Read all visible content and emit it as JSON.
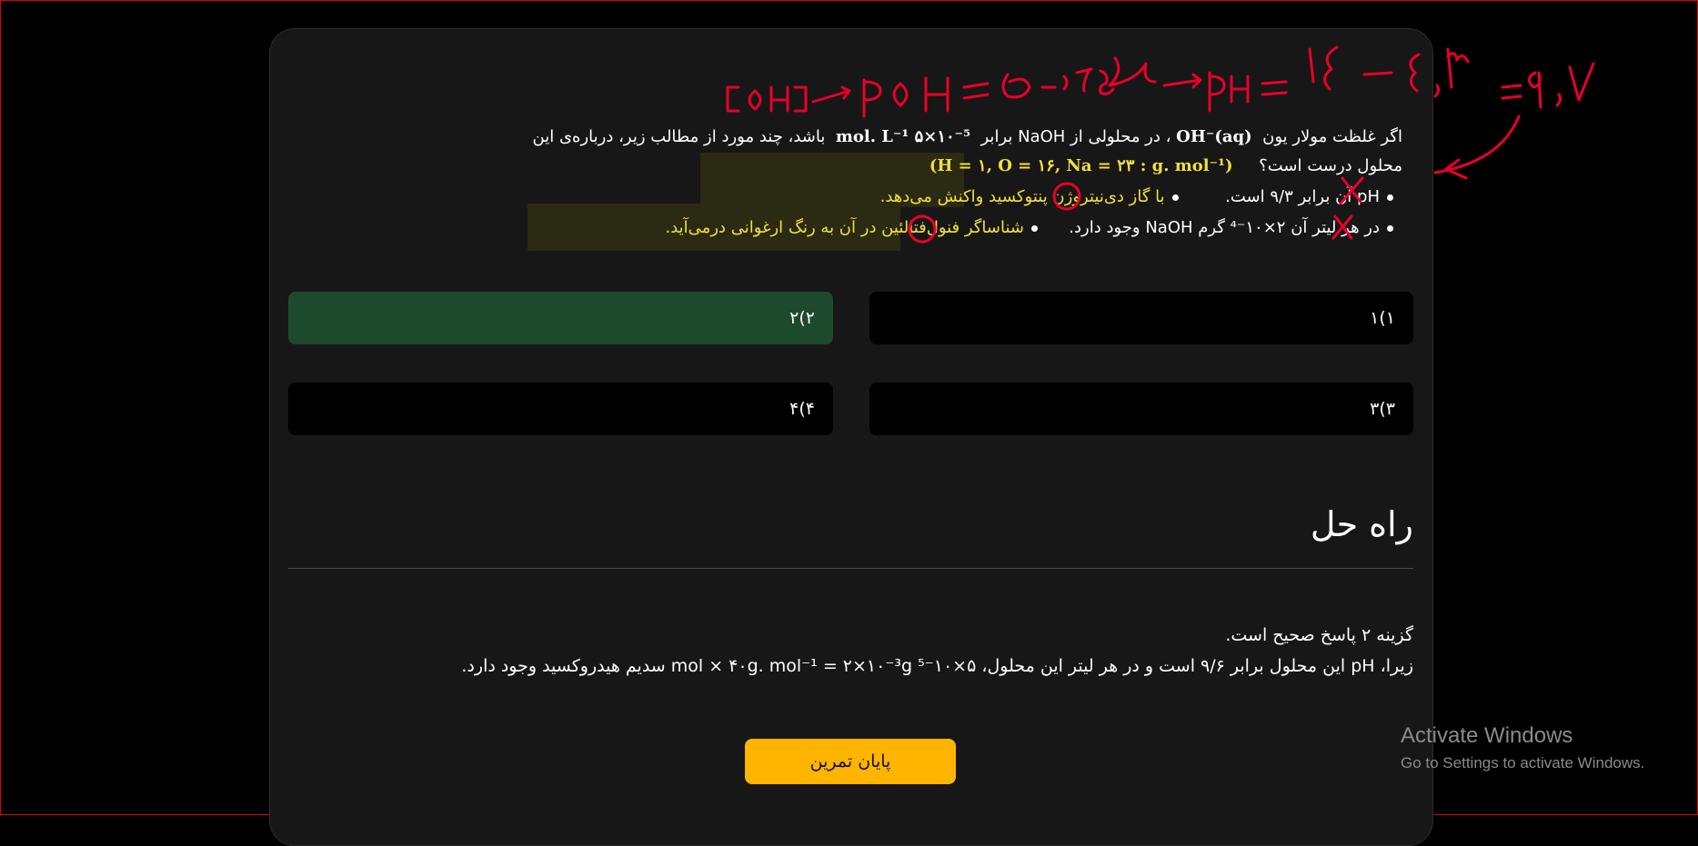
{
  "question": {
    "line1_a": "اگر غلظت مولار یون",
    "line1_ion": "OH⁻(aq)",
    "line1_b": "، در محلولی از NaOH برابر",
    "line1_conc": "mol. L⁻¹ ۵×۱۰⁻⁵",
    "line1_c": "باشد، چند مورد از مطالب زیر، درباره‌ی این",
    "line2_a": "محلول درست است؟",
    "line2_masses": "(H = ۱, O = ۱۶, Na = ۲۳ : g. mol⁻¹)",
    "bullets": [
      {
        "text": "pH آن برابر ۹/۳ است.",
        "extra": "با گاز دی‌نیتروژن پنتوکسید واکنش می‌دهد."
      },
      {
        "text": "در هر لیتر آن ۲×۱۰⁻⁴ گرم NaOH وجود دارد.",
        "extra": "شناساگر فنول‌فتالئین در آن به رنگ ارغوانی درمی‌آید."
      }
    ]
  },
  "options": [
    {
      "label": "۱)۱",
      "selected": false
    },
    {
      "label": "۲)۲",
      "selected": true
    },
    {
      "label": "۳)۳",
      "selected": false
    },
    {
      "label": "۴)۴",
      "selected": false
    }
  ],
  "solution": {
    "title": "راه حل",
    "line1": "گزینه ۲ پاسخ صحیح است.",
    "line2": "زیرا، pH این محلول برابر ۹/۶ است و در هر لیتر این محلول، ۵×۱۰⁻⁵ mol × ۴۰g. mol⁻¹ = ۲×۱۰⁻³g سدیم هیدروکسید وجود دارد."
  },
  "finish_label": "پایان تمرین",
  "windows_watermark": {
    "title": "Activate Windows",
    "subtitle": "Go to Settings to activate Windows."
  },
  "annotations": {
    "handwriting": "[OH⁻] → pOH = ۵-۰.۷ = ۴.۳ → pH = ۱۴ - ۴.۳ = ۹.۷",
    "marks": [
      "✗",
      "✗"
    ]
  },
  "colors": {
    "background": "#000000",
    "card": "#171717",
    "selected_option": "#1d4a2c",
    "option": "#000000",
    "finish_button": "#ffb400",
    "annotation_red": "#e8002a",
    "highlight_text": "#f0e040"
  }
}
